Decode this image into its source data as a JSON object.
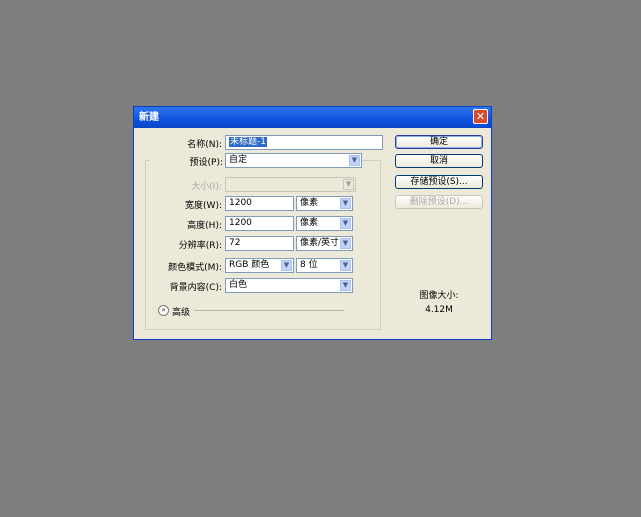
{
  "dialog": {
    "title": "新建",
    "close_glyph": "✕",
    "name_label": "名称(N):",
    "name_value": "未标题-1",
    "preset_label": "预设(P):",
    "preset_value": "自定",
    "size_label": "大小(I):",
    "width_label": "宽度(W):",
    "width_value": "1200",
    "width_unit": "像素",
    "height_label": "高度(H):",
    "height_value": "1200",
    "height_unit": "像素",
    "resolution_label": "分辨率(R):",
    "resolution_value": "72",
    "resolution_unit": "像素/英寸",
    "color_mode_label": "颜色模式(M):",
    "color_mode_value": "RGB 颜色",
    "bit_depth_value": "8 位",
    "background_label": "背景内容(C):",
    "background_value": "白色",
    "advanced_label": "高级",
    "advanced_glyph": "»",
    "buttons": {
      "ok": "确定",
      "cancel": "取消",
      "save_preset": "存储预设(S)...",
      "delete_preset": "删除预设(D)..."
    },
    "image_size_label": "图像大小:",
    "image_size_value": "4.12M"
  },
  "arrow_glyph": "▼",
  "colors": {
    "desktop": "#7f7e7f",
    "titlebar": "#0f55e0",
    "dialog_bg": "#ece9d8"
  }
}
